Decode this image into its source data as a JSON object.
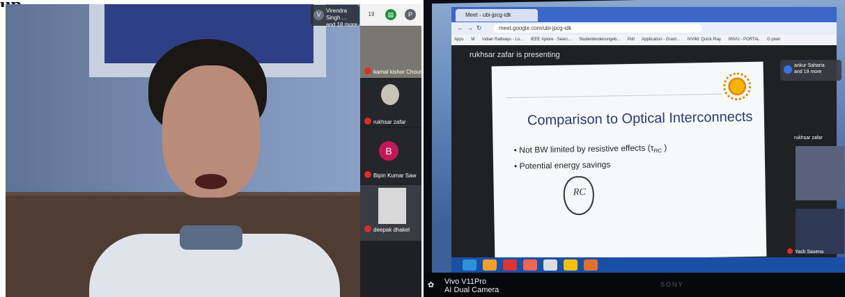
{
  "left_call": {
    "header_partial": "up",
    "participants_pill": {
      "avatar_letter": "V",
      "line1": "Virendra Singh ...",
      "line2": "and 18 more"
    },
    "top_icons": {
      "participants_count": "19",
      "chat_badge": "",
      "avatar_letter": "P"
    },
    "tiles": [
      {
        "name": "kamal kishor Choure"
      },
      {
        "name": "rukhsar zafar"
      },
      {
        "name": "Bipin Kumar Saw",
        "avatar_letter": "B"
      },
      {
        "name": "deepak dhakel"
      }
    ]
  },
  "right_call": {
    "tab_title": "Meet - ubi-jpcg-idk",
    "url": "meet.google.com/ubi-jpcg-idk",
    "bookmarks": [
      "Apps",
      "M",
      "Indian Railways - Lo...",
      "IEEE Xplore - Searc...",
      "Studentendenungeb...",
      "Poll",
      "Application - Grant...",
      "IVVIM: Quick Play",
      "IINVU - PORTAL",
      "G pixel"
    ],
    "presenting": "rukhsar zafar is presenting",
    "join_pill": {
      "line1": "ankur Saharia",
      "line2": "and 19 more"
    },
    "slide": {
      "title": "Comparison to Optical Interconnects",
      "bullets": [
        "Not BW limited by resistive effects (τ",
        "Potential energy savings"
      ],
      "subscript": "RC",
      "bullet_tail": " )",
      "scribble": "RC"
    },
    "side_label": "rukhsar zafar",
    "side_name": "Yash Saxena",
    "camera_line1": "Vivo V11Pro",
    "camera_line2": "AI Dual Camera",
    "bezel_brand": "SONY"
  }
}
